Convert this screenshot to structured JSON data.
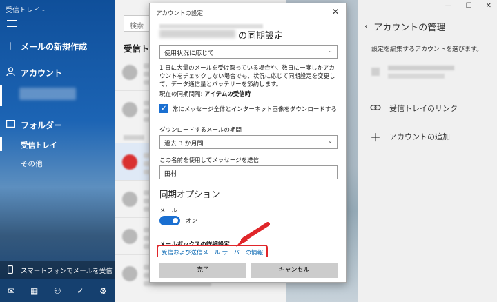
{
  "nav": {
    "app_title": "受信トレイ -",
    "new_mail": "メールの新規作成",
    "accounts": "アカウント",
    "folders": "フォルダー",
    "inbox": "受信トレイ",
    "other": "その他",
    "phone_mail": "スマートフォンでメールを受信"
  },
  "list": {
    "search_placeholder": "検索",
    "title": "受信トレイ"
  },
  "window_controls": {
    "minimize": "—",
    "maximize": "☐",
    "close": "✕"
  },
  "manage": {
    "title": "アカウントの管理",
    "back_icon": "‹",
    "description": "設定を編集するアカウントを選びます。",
    "link_inbox": "受信トレイのリンク",
    "add_account": "アカウントの追加"
  },
  "dialog": {
    "title": "アカウントの設定",
    "close_icon": "✕",
    "sync_heading": "の同期設定",
    "download_mode": "使用状況に応じて",
    "note": "1 日に大量のメールを受け取っている場合や、数日に一度しかアカウントをチェックしない場合でも、状況に応じて同期設定を変更して、データ通信量とバッテリーを節約します。",
    "interval_label": "現在の同期間隔: ",
    "interval_value": "アイテムの受信時",
    "checkbox_label": "常にメッセージ全体とインターネット画像をダウンロードする",
    "period_label": "ダウンロードするメールの期間",
    "period_value": "過去 3 か月間",
    "send_name_label": "この名前を使用してメッセージを送信",
    "send_name_value": "田村",
    "sync_options": "同期オプション",
    "mail_label": "メール",
    "mail_toggle": "オン",
    "mailbox_label": "メールボックスの詳細設定",
    "server_link": "受信および送信メール サーバーの情報",
    "done": "完了",
    "cancel": "キャンセル"
  },
  "colors": {
    "accent": "#1a6fd1",
    "highlight": "#e0262a",
    "link": "#0063b1"
  }
}
